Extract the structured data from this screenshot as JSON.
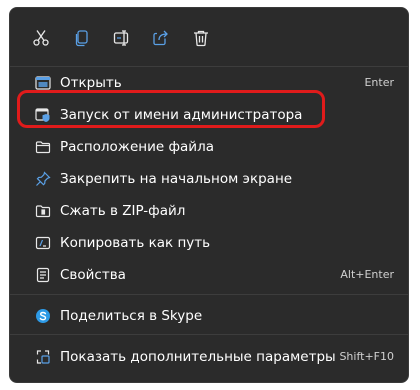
{
  "toolbar": {
    "icons": [
      "cut-icon",
      "copy-icon",
      "rename-icon",
      "share-icon",
      "delete-icon"
    ]
  },
  "menu": {
    "items": [
      {
        "label": "Открыть",
        "shortcut": "Enter",
        "icon": "open-app-icon"
      },
      {
        "label": "Запуск от имени администратора",
        "shortcut": "",
        "icon": "shield-icon"
      },
      {
        "label": "Расположение файла",
        "shortcut": "",
        "icon": "folder-icon"
      },
      {
        "label": "Закрепить на начальном экране",
        "shortcut": "",
        "icon": "pin-icon"
      },
      {
        "label": "Сжать в ZIP-файл",
        "shortcut": "",
        "icon": "zip-folder-icon"
      },
      {
        "label": "Копировать как путь",
        "shortcut": "",
        "icon": "copy-path-icon"
      },
      {
        "label": "Свойства",
        "shortcut": "Alt+Enter",
        "icon": "properties-icon"
      },
      {
        "label": "Поделиться в Skype",
        "shortcut": "",
        "icon": "skype-icon"
      },
      {
        "label": "Показать дополнительные параметры",
        "shortcut": "Shift+F10",
        "icon": "more-options-icon"
      }
    ]
  },
  "colors": {
    "menu_background": "#2b2b2b",
    "text": "#ffffff",
    "highlight_border": "#e01b1b",
    "accent_blue": "#5aa0e6"
  }
}
